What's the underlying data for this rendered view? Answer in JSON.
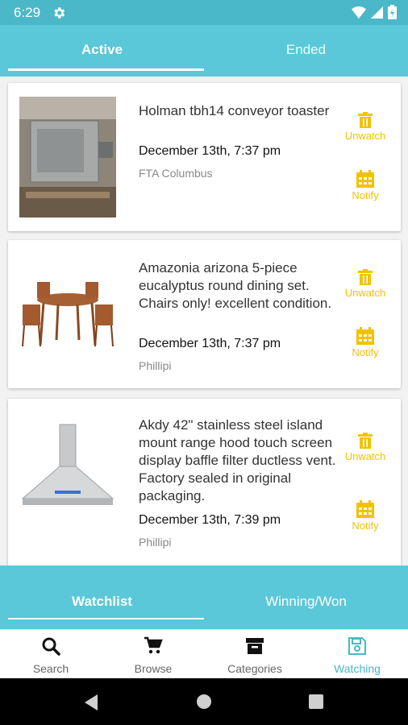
{
  "status_bar": {
    "time": "6:29"
  },
  "top_tabs": {
    "active": "Active",
    "ended": "Ended"
  },
  "items": [
    {
      "title": "Holman tbh14 conveyor toaster",
      "date": "December 13th, 7:37 pm",
      "location": "FTA Columbus",
      "unwatch": "Unwatch",
      "notify": "Notify"
    },
    {
      "title": "Amazonia arizona 5-piece eucalyptus round dining set. Chairs only! excellent condition.",
      "date": "December 13th, 7:37 pm",
      "location": "Phillipi",
      "unwatch": "Unwatch",
      "notify": "Notify"
    },
    {
      "title": "Akdy 42\" stainless steel island mount range hood touch screen display baffle filter ductless vent. Factory sealed in original packaging.",
      "date": "December 13th, 7:39 pm",
      "location": "Phillipi",
      "unwatch": "Unwatch",
      "notify": "Notify"
    }
  ],
  "bottom_tabs": {
    "watchlist": "Watchlist",
    "winning": "Winning/Won"
  },
  "nav": {
    "items": [
      {
        "label": "Search",
        "icon": "search-icon"
      },
      {
        "label": "Browse",
        "icon": "cart-icon"
      },
      {
        "label": "Categories",
        "icon": "archive-icon"
      },
      {
        "label": "Watching",
        "icon": "save-icon"
      }
    ],
    "active_index": 3
  },
  "colors": {
    "primary": "#5ac8d8",
    "accent": "#f2c200",
    "status": "#4ab8c8"
  }
}
